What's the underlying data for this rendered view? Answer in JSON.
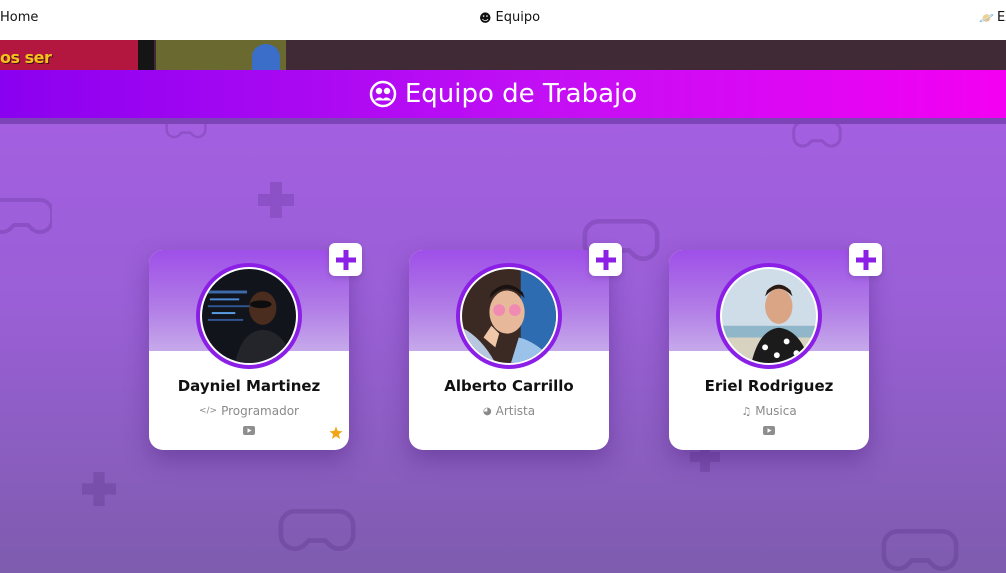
{
  "nav": {
    "home_label": "Home",
    "team_label": "Equipo",
    "extra_label": "Ex"
  },
  "banner": {
    "partial_text": "os ser"
  },
  "section": {
    "title": "Equipo de Trabajo"
  },
  "colors": {
    "accent": "#8b1fe6",
    "header_gradient_start": "#8a00f0",
    "header_gradient_end": "#f400f2",
    "star": "#f2a515"
  },
  "team": [
    {
      "name": "Dayniel Martinez",
      "role": "Programador",
      "role_icon": "code-icon",
      "has_star": true
    },
    {
      "name": "Alberto Carrillo",
      "role": "Artista",
      "role_icon": "palette-icon",
      "has_star": false
    },
    {
      "name": "Eriel Rodriguez",
      "role": "Musica",
      "role_icon": "music-note-icon",
      "has_star": false
    }
  ]
}
